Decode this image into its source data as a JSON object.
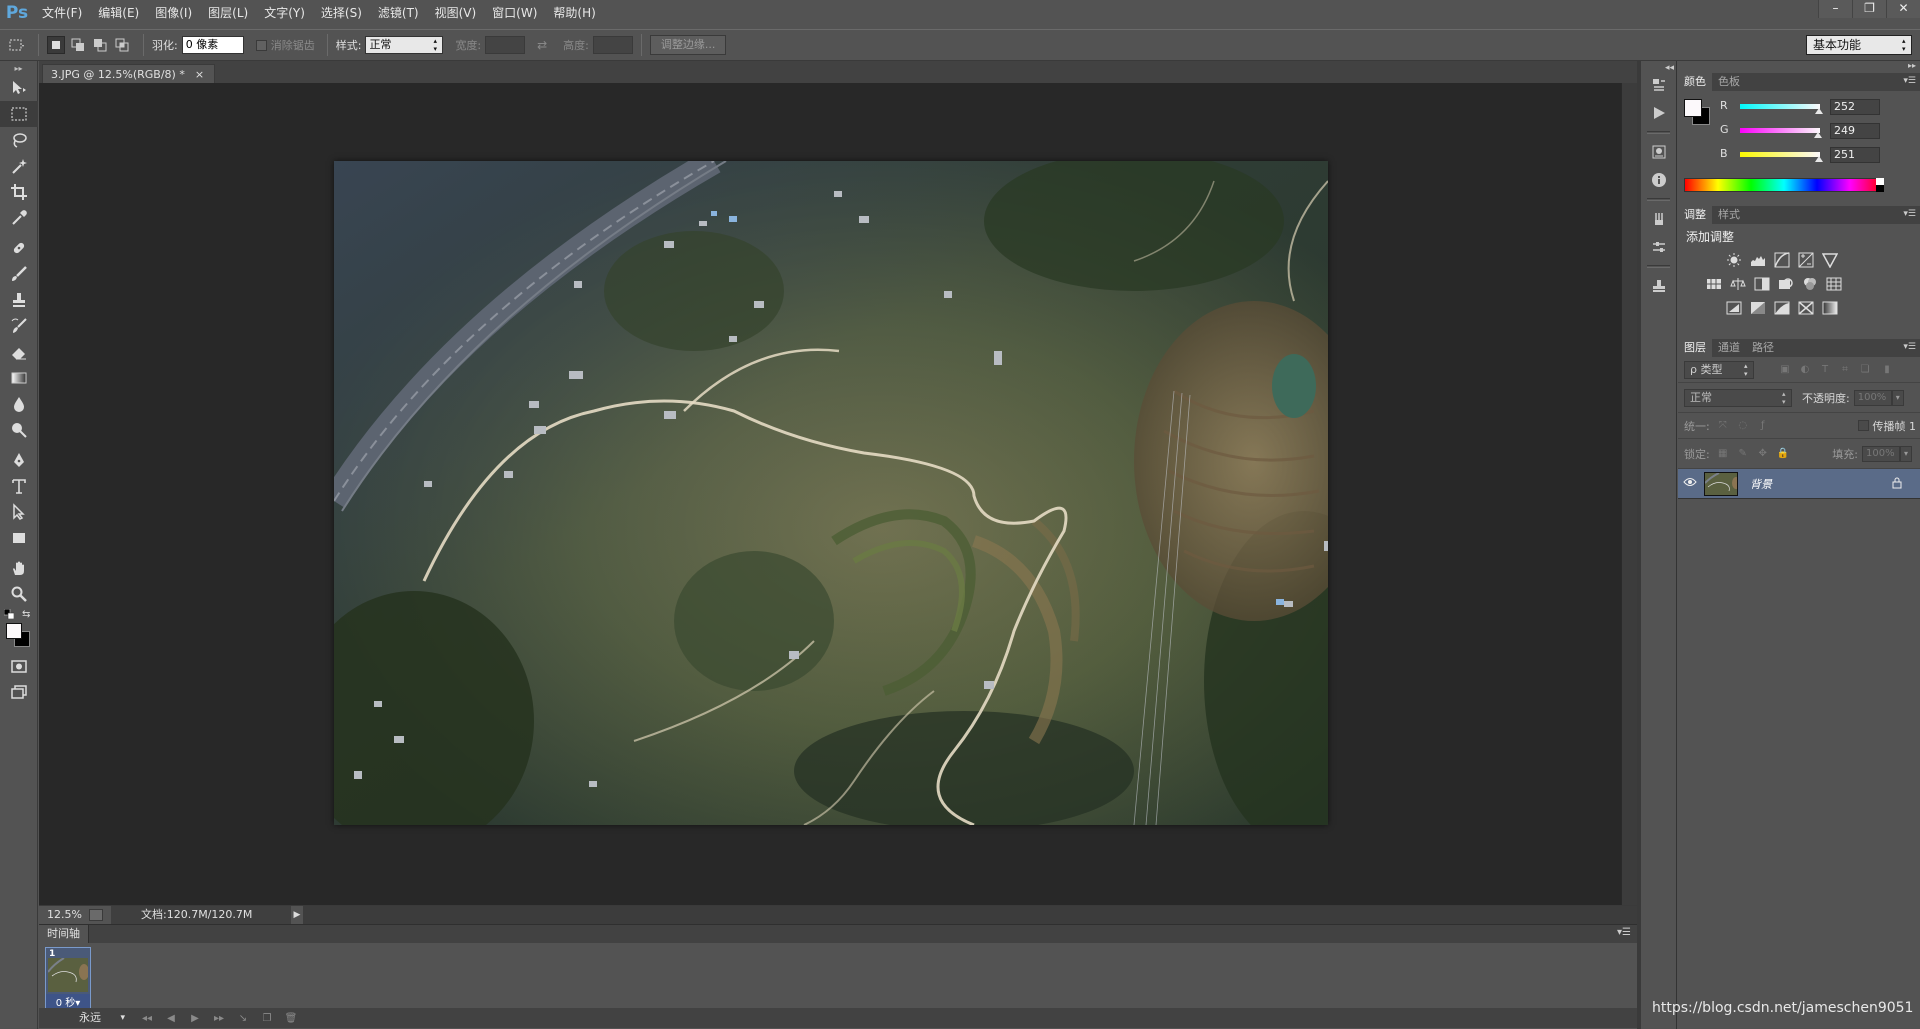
{
  "app": {
    "logo": "Ps"
  },
  "menu": [
    {
      "label": "文件(F)",
      "name": "menu-file"
    },
    {
      "label": "编辑(E)",
      "name": "menu-edit"
    },
    {
      "label": "图像(I)",
      "name": "menu-image"
    },
    {
      "label": "图层(L)",
      "name": "menu-layer"
    },
    {
      "label": "文字(Y)",
      "name": "menu-type"
    },
    {
      "label": "选择(S)",
      "name": "menu-select"
    },
    {
      "label": "滤镜(T)",
      "name": "menu-filter"
    },
    {
      "label": "视图(V)",
      "name": "menu-view"
    },
    {
      "label": "窗口(W)",
      "name": "menu-window"
    },
    {
      "label": "帮助(H)",
      "name": "menu-help"
    }
  ],
  "window_controls": {
    "minimize": "–",
    "restore": "❐",
    "close": "✕"
  },
  "options": {
    "feather_label": "羽化:",
    "feather_value": "0 像素",
    "antialias_label": "消除锯齿",
    "style_label": "样式:",
    "style_value": "正常",
    "width_label": "宽度:",
    "height_label": "高度:",
    "refine_edge_label": "调整边缘...",
    "workspace": "基本功能"
  },
  "document": {
    "tab_title": "3.JPG @ 12.5%(RGB/8) *",
    "tab_close": "×",
    "zoom": "12.5%",
    "doc_size": "文档:120.7M/120.7M"
  },
  "timeline": {
    "title": "时间轴",
    "frame_number": "1",
    "frame_delay": "0 秒▾",
    "loop": "永远"
  },
  "panels": {
    "color": {
      "tabs": [
        "颜色",
        "色板"
      ],
      "r_label": "R",
      "g_label": "G",
      "b_label": "B",
      "r": "252",
      "g": "249",
      "b": "251",
      "fg_color": "#fcf9fb",
      "r_fraction": 0.988,
      "g_fraction": 0.976,
      "b_fraction": 0.984
    },
    "adjustments": {
      "tabs": [
        "调整",
        "样式"
      ],
      "title": "添加调整"
    },
    "layers": {
      "tabs": [
        "图层",
        "通道",
        "路径"
      ],
      "filter_kind": "ρ 类型",
      "blend_mode": "正常",
      "opacity_label": "不透明度:",
      "opacity_value": "100%",
      "unify_label": "统一:",
      "propagate_label": "传播帧 1",
      "lock_label": "锁定:",
      "fill_label": "填充:",
      "fill_value": "100%",
      "layer_name": "背景"
    }
  },
  "watermark": "https://blog.csdn.net/jameschen9051",
  "colors": {
    "ui_bg": "#535353",
    "canvas_bg": "#282828",
    "selected_layer": "#5a6b88",
    "logo_blue": "#5fa8dd"
  }
}
